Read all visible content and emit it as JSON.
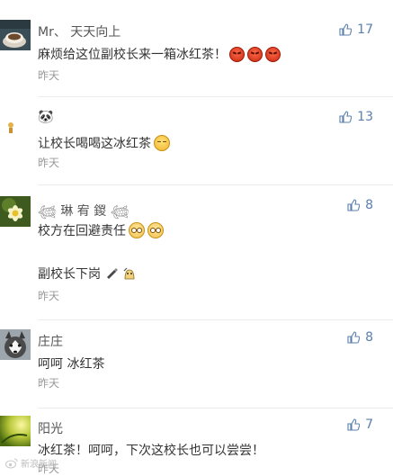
{
  "comments": [
    {
      "username": "Mr、 天天向上",
      "text": "麻烦给这位副校长来一箱冰红茶！",
      "time": "昨天",
      "likes": "17",
      "avatar_icon": "coffee-cup-avatar",
      "emojis": [
        "angry-face",
        "angry-face",
        "angry-face"
      ]
    },
    {
      "username": "🐼",
      "text": "让校长喝喝这冰红茶",
      "time": "昨天",
      "likes": "13",
      "avatar_icon": "small-figure-avatar",
      "emojis": [
        "smug-face"
      ]
    },
    {
      "username": "𓆉 琳 宥 鍐 𓆉",
      "text": "校方在回避责任",
      "text2": "副校长下岗",
      "time": "昨天",
      "likes": "8",
      "avatar_icon": "flower-avatar",
      "emojis": [
        "blank-face",
        "blank-face"
      ],
      "emojis2": [
        "pen-icon",
        "ghost-icon"
      ]
    },
    {
      "username": "庄庄",
      "text": "呵呵 冰红茶",
      "time": "昨天",
      "likes": "8",
      "avatar_icon": "husky-dog-avatar"
    },
    {
      "username": "阳光",
      "text": "冰红茶！呵呵，下次这校长也可以尝尝！",
      "time": "昨天",
      "likes": "7",
      "avatar_icon": "sunlight-leaf-avatar"
    }
  ],
  "watermark": "新浪新闻",
  "colors": {
    "name": "#555555",
    "text": "#333333",
    "time": "#999999",
    "like": "#5a7fae"
  }
}
